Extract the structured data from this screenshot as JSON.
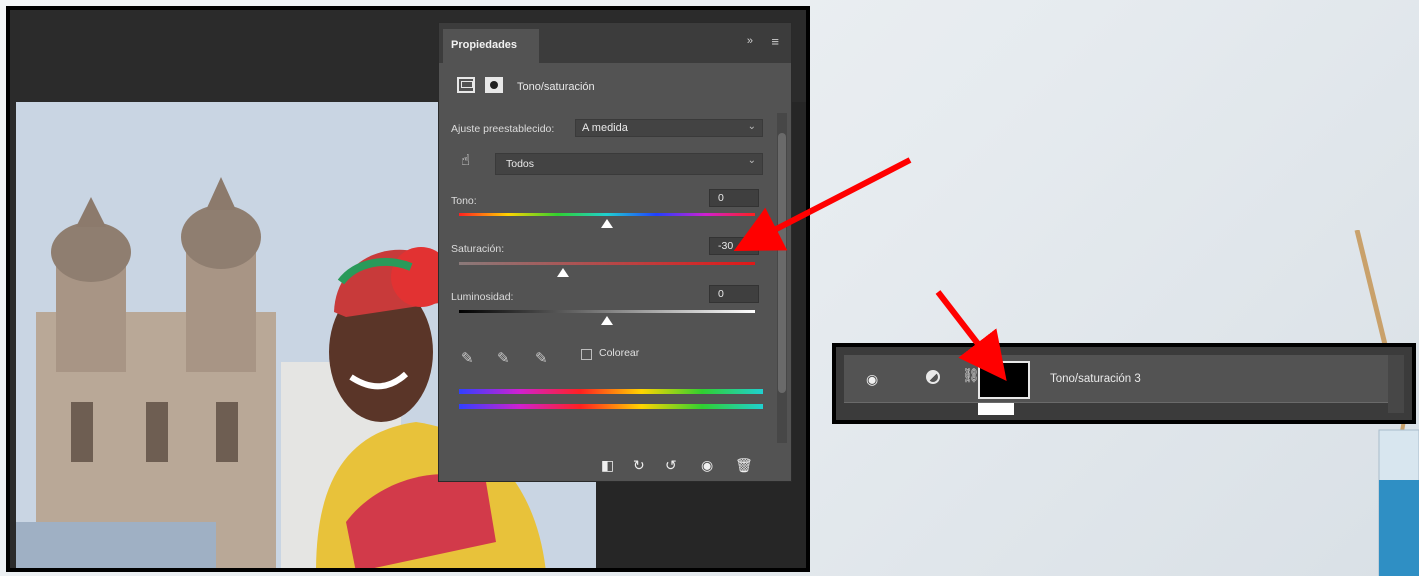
{
  "properties_panel": {
    "tab_label": "Propiedades",
    "collapse_glyph": "»",
    "menu_glyph": "≡",
    "adjustment_title": "Tono/saturación",
    "preset_label": "Ajuste preestablecido:",
    "preset_value": "A medida",
    "channel_value": "Todos",
    "sliders": {
      "hue": {
        "label": "Tono:",
        "value": "0"
      },
      "saturation": {
        "label": "Saturación:",
        "value": "-30"
      },
      "lightness": {
        "label": "Luminosidad:",
        "value": "0"
      }
    },
    "colorize_label": "Colorear",
    "footer_icons": [
      "clip-to-layer-icon",
      "view-previous-icon",
      "reset-icon",
      "visibility-icon",
      "delete-icon"
    ]
  },
  "layers_panel": {
    "layer_name": "Tono/saturación 3",
    "icons": [
      "eye-icon",
      "adjustment-layer-icon",
      "chain-link-icon"
    ]
  },
  "annotations": {
    "arrow_color": "#ff0000"
  }
}
